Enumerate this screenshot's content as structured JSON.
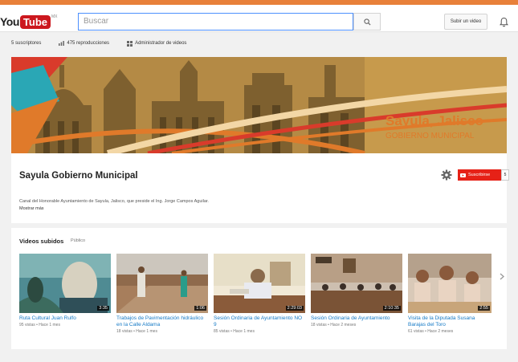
{
  "header": {
    "logo_you": "You",
    "logo_tube": "Tube",
    "logo_country": "MX",
    "search_placeholder": "Buscar",
    "upload_label": "Subir un video"
  },
  "stats": {
    "subscribers": "5 suscriptores",
    "views": "475 reproducciones",
    "manager": "Administrador de videos"
  },
  "banner": {
    "title": "Sayula, Jalisco",
    "subtitle": "GOBIERNO MUNICIPAL"
  },
  "channel": {
    "name": "Sayula Gobierno Municipal",
    "subscribe_label": "Suscribirse",
    "subscribe_count": "5",
    "description": "Canal del Honorable Ayuntamiento de Sayula, Jalisco, que preside el Ing. Jorge Campos Aguilar.",
    "more_label": "Mostrar más"
  },
  "videos": {
    "section_title": "Videos subidos",
    "section_visibility": "Público",
    "items": [
      {
        "title": "Ruta Cultural Juan Rulfo",
        "meta": "95 vistas • Hace 1 mes",
        "duration": "3:35"
      },
      {
        "title": "Trabajos de Pavimentación hidráulico en la Calle Aldama",
        "meta": "18 vistas • Hace 1 mes",
        "duration": "1:06"
      },
      {
        "title": "Sesión Ordinaria de Ayuntamiento NO 9",
        "meta": "85 vistas • Hace 1 mes",
        "duration": "2:29:03"
      },
      {
        "title": "Sesión Ordinaria de Ayuntamiento",
        "meta": "18 vistas • Hace 2 meses",
        "duration": "2:10:35"
      },
      {
        "title": "Visita de la Diputada Susana Barajas del Toro",
        "meta": "61 vistas • Hace 2 meses",
        "duration": "2:55"
      }
    ]
  },
  "colors": {
    "accent": "#e07a2a",
    "youtube_red": "#cc181e",
    "link": "#167ac6"
  }
}
